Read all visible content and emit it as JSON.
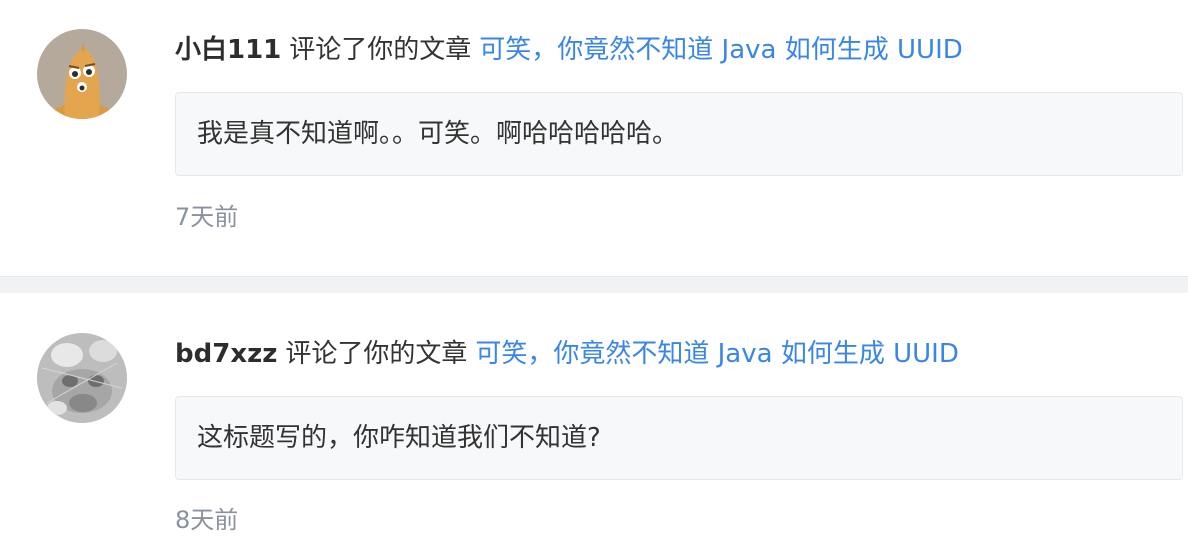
{
  "notifications": [
    {
      "user": "小白111",
      "action": "评论了你的文章",
      "article": "可笑，你竟然不知道 Java 如何生成 UUID",
      "comment": "我是真不知道啊。。可笑。啊哈哈哈哈哈。",
      "time": "7天前",
      "avatar": "cartoon-avatar"
    },
    {
      "user": "bd7xzz",
      "action": "评论了你的文章",
      "article": "可笑，你竟然不知道 Java 如何生成 UUID",
      "comment": "这标题写的，你咋知道我们不知道?",
      "time": "8天前",
      "avatar": "photo-avatar"
    }
  ],
  "colors": {
    "link": "#3a86e8",
    "text": "#333333",
    "muted": "#8a919f",
    "comment_bg": "#f7f8fa",
    "separator": "#f1f2f4"
  }
}
